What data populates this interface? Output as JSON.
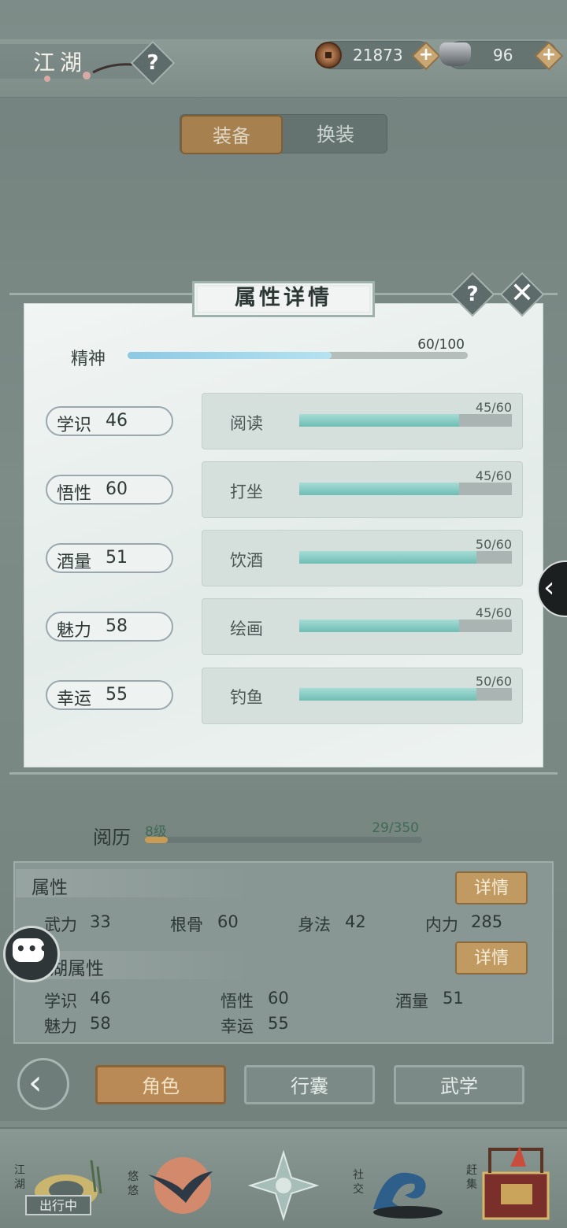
{
  "header": {
    "title": "江湖",
    "help_icon": "?",
    "coins": {
      "value": "21873",
      "icon": "coin-icon"
    },
    "silver": {
      "value": "96",
      "icon": "silver-ingot-icon"
    },
    "plus": "+"
  },
  "top_tabs": [
    {
      "label": "装备",
      "active": true
    },
    {
      "label": "换装",
      "active": false
    }
  ],
  "modal": {
    "title": "属性详情",
    "help": "?",
    "close": "✕",
    "spirit": {
      "label": "精神",
      "value_text": "60/100",
      "progress": 0.6
    },
    "stats": [
      {
        "name": "学识",
        "value": "46",
        "activity": "阅读",
        "progress_text": "45/60",
        "progress": 0.75
      },
      {
        "name": "悟性",
        "value": "60",
        "activity": "打坐",
        "progress_text": "45/60",
        "progress": 0.75
      },
      {
        "name": "酒量",
        "value": "51",
        "activity": "饮酒",
        "progress_text": "50/60",
        "progress": 0.8333
      },
      {
        "name": "魅力",
        "value": "58",
        "activity": "绘画",
        "progress_text": "45/60",
        "progress": 0.75
      },
      {
        "name": "幸运",
        "value": "55",
        "activity": "钓鱼",
        "progress_text": "50/60",
        "progress": 0.8333
      }
    ]
  },
  "side_arrow": "‹",
  "experience": {
    "label": "阅历",
    "level": "8级",
    "value_text": "29/350",
    "progress": 0.0829
  },
  "attributes": {
    "title": "属性",
    "detail_label": "详情",
    "items": [
      {
        "name": "武力",
        "value": "33"
      },
      {
        "name": "根骨",
        "value": "60"
      },
      {
        "name": "身法",
        "value": "42"
      },
      {
        "name": "内力",
        "value": "285"
      }
    ]
  },
  "jianghu_attributes": {
    "title": "江湖属性",
    "detail_label": "详情",
    "items": [
      {
        "name": "学识",
        "value": "46"
      },
      {
        "name": "悟性",
        "value": "60"
      },
      {
        "name": "酒量",
        "value": "51"
      },
      {
        "name": "魅力",
        "value": "58"
      },
      {
        "name": "幸运",
        "value": "55"
      }
    ]
  },
  "nav_tabs": [
    {
      "label": "角色",
      "active": true
    },
    {
      "label": "行囊",
      "active": false
    },
    {
      "label": "武学",
      "active": false
    }
  ],
  "back_icon": "back-chevron-icon",
  "chat_icon": "chat-icon",
  "dock": [
    {
      "label": "江湖",
      "status": "出行中",
      "icon": "jianghu-scene-icon"
    },
    {
      "label": "悠悠",
      "icon": "swallow-icon"
    },
    {
      "label": "",
      "icon": "compass-star-icon"
    },
    {
      "label": "社交",
      "icon": "wave-icon"
    },
    {
      "label": "赶集",
      "icon": "market-chest-icon"
    }
  ]
}
